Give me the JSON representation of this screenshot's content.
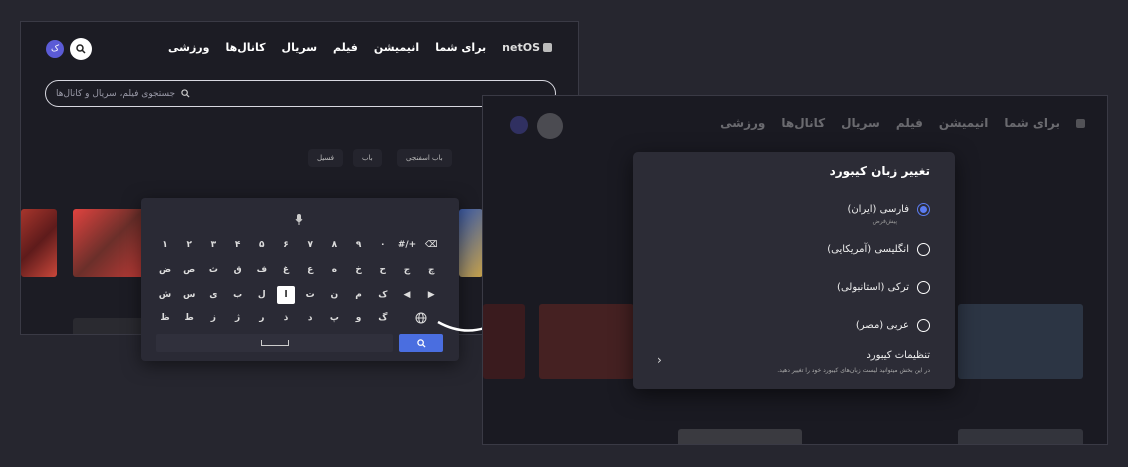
{
  "left_screen": {
    "nav_items": [
      "برای شما",
      "انیمیشن",
      "فیلم",
      "سریال",
      "کانال‌ها",
      "ورزشی"
    ],
    "logo_text": "netOS",
    "avatar_letter": "ک",
    "search_placeholder": "جستجوی فیلم، سریال و کانال‌ها",
    "chips": [
      "فسیل",
      "باب",
      "باب اسفنجی"
    ]
  },
  "keyboard": {
    "rows": [
      [
        "۱",
        "۲",
        "۳",
        "۴",
        "۵",
        "۶",
        "۷",
        "۸",
        "۹",
        "۰",
        "#/+",
        "⌫"
      ],
      [
        "ض",
        "ص",
        "ث",
        "ق",
        "ف",
        "غ",
        "ع",
        "ه",
        "خ",
        "ح",
        "ج",
        "چ"
      ],
      [
        "ش",
        "س",
        "ی",
        "ب",
        "ل",
        "ا",
        "ت",
        "ن",
        "م",
        "ک",
        "◀",
        "▶"
      ],
      [
        "ظ",
        "ط",
        "ز",
        "ژ",
        "ر",
        "ذ",
        "د",
        "پ",
        "و",
        "گ",
        "",
        ""
      ]
    ],
    "active_key": "ا",
    "mic_icon": "microphone-icon",
    "globe_icon": "globe-icon",
    "search_icon": "search-icon"
  },
  "right_screen": {
    "nav_items": [
      "برای شما",
      "انیمیشن",
      "فیلم",
      "سریال",
      "کانال‌ها",
      "ورزشی"
    ],
    "dialog": {
      "title": "تغییر زبان کیبورد",
      "options": [
        {
          "label": "فارسی (ایران)",
          "sub": "پیش‌فرض",
          "selected": true
        },
        {
          "label": "انگلیسی (آمریکایی)",
          "sub": "",
          "selected": false
        },
        {
          "label": "ترکی (استانبولی)",
          "sub": "",
          "selected": false
        },
        {
          "label": "عربی (مصر)",
          "sub": "",
          "selected": false
        }
      ],
      "settings_title": "تنظیمات کیبورد",
      "settings_desc": "در این بخش میتوانید لیست زبان‌های کیبورد خود را تغییر دهید."
    }
  },
  "colors": {
    "accent": "#4a6ee0",
    "background": "#26262f",
    "panel": "#2c2c36"
  }
}
